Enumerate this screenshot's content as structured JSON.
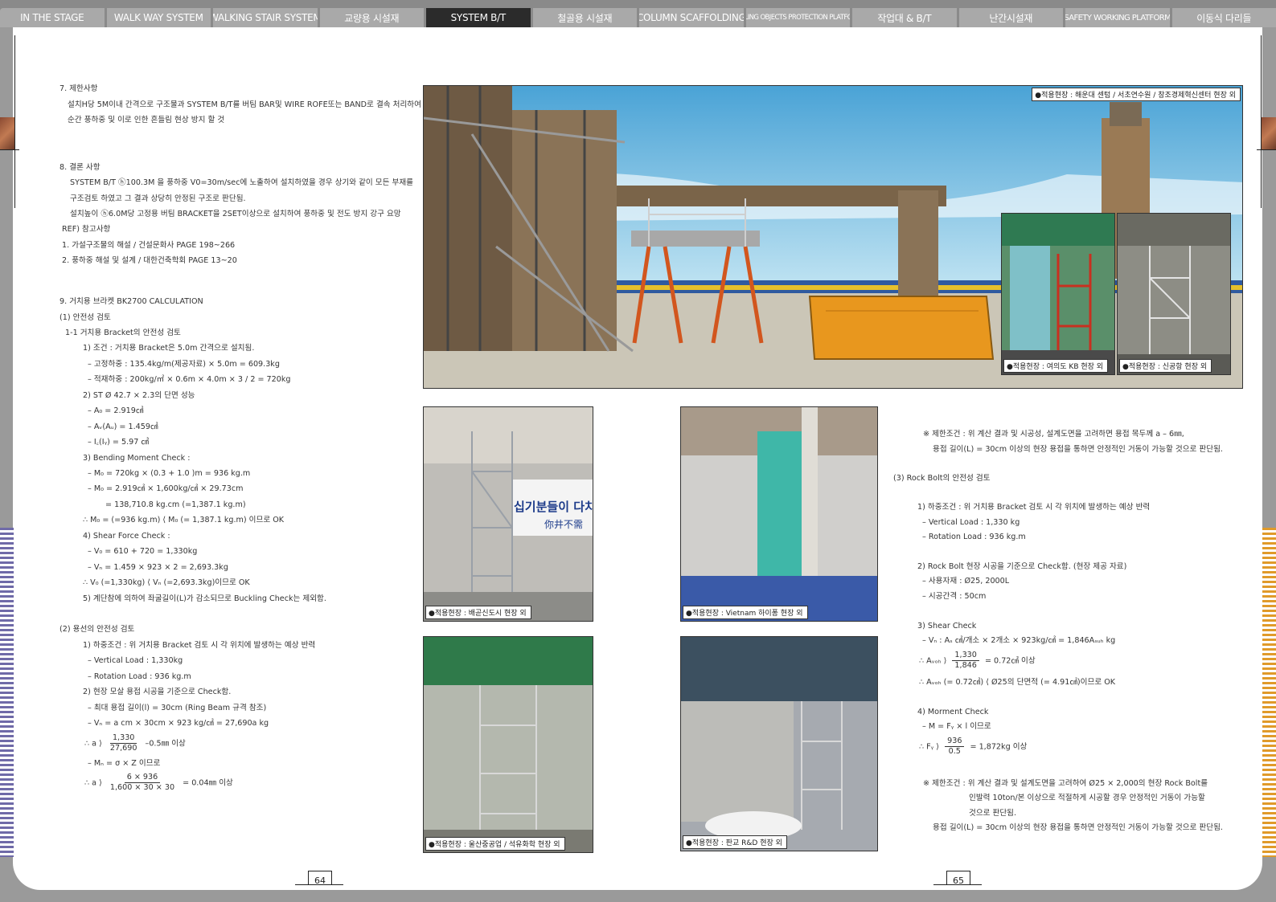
{
  "tabs": [
    {
      "label": "IN THE STAGE",
      "active": false
    },
    {
      "label": "WALK WAY SYSTEM",
      "active": false
    },
    {
      "label": "WALKING STAIR SYSTEM",
      "active": false
    },
    {
      "label": "교량용 시설재",
      "active": false
    },
    {
      "label": "SYSTEM B/T",
      "active": true
    },
    {
      "label": "철골용 시설재",
      "active": false
    },
    {
      "label": "COLUMN SCAFFOLDING",
      "active": false
    },
    {
      "label": "FALLING OBJECTS PROTECTION PLATFORM",
      "active": false
    },
    {
      "label": "작업대 & B/T",
      "active": false
    },
    {
      "label": "난간시설재",
      "active": false
    },
    {
      "label": "SAFETY WORKING PLATFORM",
      "active": false
    },
    {
      "label": "이동식 다리들",
      "active": false
    }
  ],
  "left": {
    "s7_title": "7. 제한사항",
    "s7_l1": "설치H당 5M이내 간격으로 구조물과 SYSTEM B/T를 버팀 BAR및 WIRE ROFE또는 BAND로 결속 처리하여",
    "s7_l2": "순간 풍하중 및 이로 인한 흔들림 현상 방지 할 것",
    "s8_title": "8. 결론 사항",
    "s8_l1": "SYSTEM B/T ⓗ100.3M 을 풍하중 V0=30m/sec에 노출하여 설치하였을 경우 상기와 같이 모든 부재를",
    "s8_l2": "구조검토 하였고 그 결과 상당히 안정된 구조로 판단됨.",
    "s8_l3": "설치높이 ⓗ6.0M당 고정용 버팀 BRACKET을 2SET이상으로 설치하여 풍하중 및 전도 방지 강구 요망",
    "s8_ref": "REF) 참고사항",
    "s8_r1": "1. 가설구조물의 해설 /  건설문화사 PAGE 198~266",
    "s8_r2": "2. 풍하중 해설 및 설계 / 대한건축학회 PAGE 13~20",
    "s9_title": "9. 거치용 브라켓 BK2700 CALCULATION",
    "s9_a": "(1) 안전성 검토",
    "s9_a1": "1-1 거치용 Bracket의 안전성 검토",
    "c1": "1) 조건 : 거치용 Bracket은 5.0m 간격으로 설치됨.",
    "c1a": "– 고정하중 : 135.4kg/m(제공자료) × 5.0m = 609.3kg",
    "c1b": "– 적재하중 : 200kg/㎡ × 0.6m × 4.0m × 3 / 2 = 720kg",
    "c2": "2) ST Ø 42.7 × 2.3의 단면 성능",
    "c2a": "– A₀ = 2.919㎠",
    "c2b": "– Aᵥ(Aᵤ) = 1.459㎠",
    "c2c": "– I꜀(Iᵧ) = 5.97 ㎤",
    "c3": "3) Bending Moment Check :",
    "c3a": "– M₀ = 720kg × (0.3 + 1.0 )m = 936 kg.m",
    "c3b": "– M₀ = 2.919㎠ × 1,600kg/㎠ × 29.73cm",
    "c3c": "= 138,710.8 kg.cm (=1,387.1 kg.m)",
    "c3d": "∴ M₀ = (=936 kg.m) ⟨ M₀ (= 1,387.1 kg.m) 이므로 OK",
    "c4": "4) Shear Force Check :",
    "c4a": "– V₀ = 610 + 720 = 1,330kg",
    "c4b": "– Vₙ = 1.459 × 923 × 2 = 2,693.3kg",
    "c4c": "∴ V₀ (=1,330kg) ⟨ Vₙ (=2,693.3kg)이므로 OK",
    "c5": "5) 계단참에 의하여 좌굴길이(L)가 감소되므로 Buckling Check는 제외함.",
    "s9_b": "(2) 용선의 안전성 검토",
    "d1": "1) 하중조건 : 위 거치용 Bracket 검토 시 각 위치에 발생하는 예상 반력",
    "d1a": "– Vertical Load : 1,330kg",
    "d1b": "– Rotation Load : 936 kg.m",
    "d2": "2) 현장 모살 용접 시공을 기준으로 Check함.",
    "d2a": "– 최대 용접 길이(l) = 30cm (Ring Beam 규격 참조)",
    "d2b": "– Vₙ = a cm × 30cm × 923 kg/㎠ = 27,690a kg",
    "d2c_pre": "∴ a ⟩",
    "d2c_num": "1,330",
    "d2c_den": "27,690",
    "d2c_post": "–0.5㎜ 이상",
    "d2d": "– Mₙ = σ × Z 이므로",
    "d2e_pre": "∴ a ⟩",
    "d2e_num": "6 × 936",
    "d2e_den": "1,600 × 30 × 30",
    "d2e_post": "= 0.04㎜ 이상"
  },
  "right": {
    "n1": "※ 제한조건 :  위 계산 결과 및 시공성, 설계도면을 고려하면 용접 목두께 a – 6㎜,",
    "n2": "용접 길이(L) = 30cm 이상의 현장 용접을 통하면 안정적인 거동이 가능할 것으로 판단됨.",
    "r3": "(3) Rock Bolt의 안전성 검토",
    "e1": "1) 하중조건 :  위 거치용 Bracket 검토 시 각 위치에 발생하는 예상 반력",
    "e1a": "– Vertical Load : 1,330 kg",
    "e1b": "– Rotation Load : 936 kg.m",
    "e2": "2) Rock Bolt 현장 시공을 기준으로 Check함. (현장 제공 자료)",
    "e2a": "– 사용자재 : Ø25, 2000L",
    "e2b": "– 시공간격 : 50cm",
    "e3": "3) Shear Check",
    "e3a": "– Vₙ : Aₛ ㎠/개소 × 2개소 × 923kg/㎠ = 1,846Aₛᵤₕ kg",
    "e3b_pre": "∴ Aᵥₒₕ ⟩",
    "e3b_num": "1,330",
    "e3b_den": "1,846",
    "e3b_post": "= 0.72㎠ 이상",
    "e3c": "∴ Aᵥₒₕ (= 0.72㎠) ⟨ Ø25의 단면적 (= 4.91㎠)이므로 OK",
    "e4": "4) Morment Check",
    "e4a": "– M = Fᵧ × l 이므로",
    "e4b_pre": "∴ Fᵧ ⟩",
    "e4b_num": "936",
    "e4b_den": "0.5",
    "e4b_post": "= 1,872kg 이상",
    "n3": "※ 제한조건 : 위 계산 결과 및 설계도면을 고려하여 Ø25 × 2,000의 현장 Rock Bolt를",
    "n4": "인발력 10ton/본 이상으로 적절하게 시공할 경우 안정적인 거동이 가능할",
    "n5": "것으로 판단됨.",
    "n6": "용접 길이(L) = 30cm 이상의 현장 용접을 통하면 안정적인 거동이 가능할 것으로 판단됨."
  },
  "photos": {
    "main": "●적용현장 :  해운대 센텀 / 서초연수원 / 창조경제혁신센터 현장 외",
    "inset1": "●적용현장 : 여의도 KB 현장 외",
    "inset2": "●적용현장 : 신공항 현장 외",
    "p1": "●적용현장 : 배곧신도시 현장 외",
    "p2": "●적용현장 : Vietnam 하이퐁 현장 외",
    "p3": "●적용현장 : 울산중공업 / 석유화학 현장 외",
    "p4": "●적용현장 :  판교 R&D 현장 외",
    "sign1": "십기분들이 다치",
    "sign2": "你井不需"
  },
  "pages": {
    "left": "64",
    "right": "65"
  }
}
